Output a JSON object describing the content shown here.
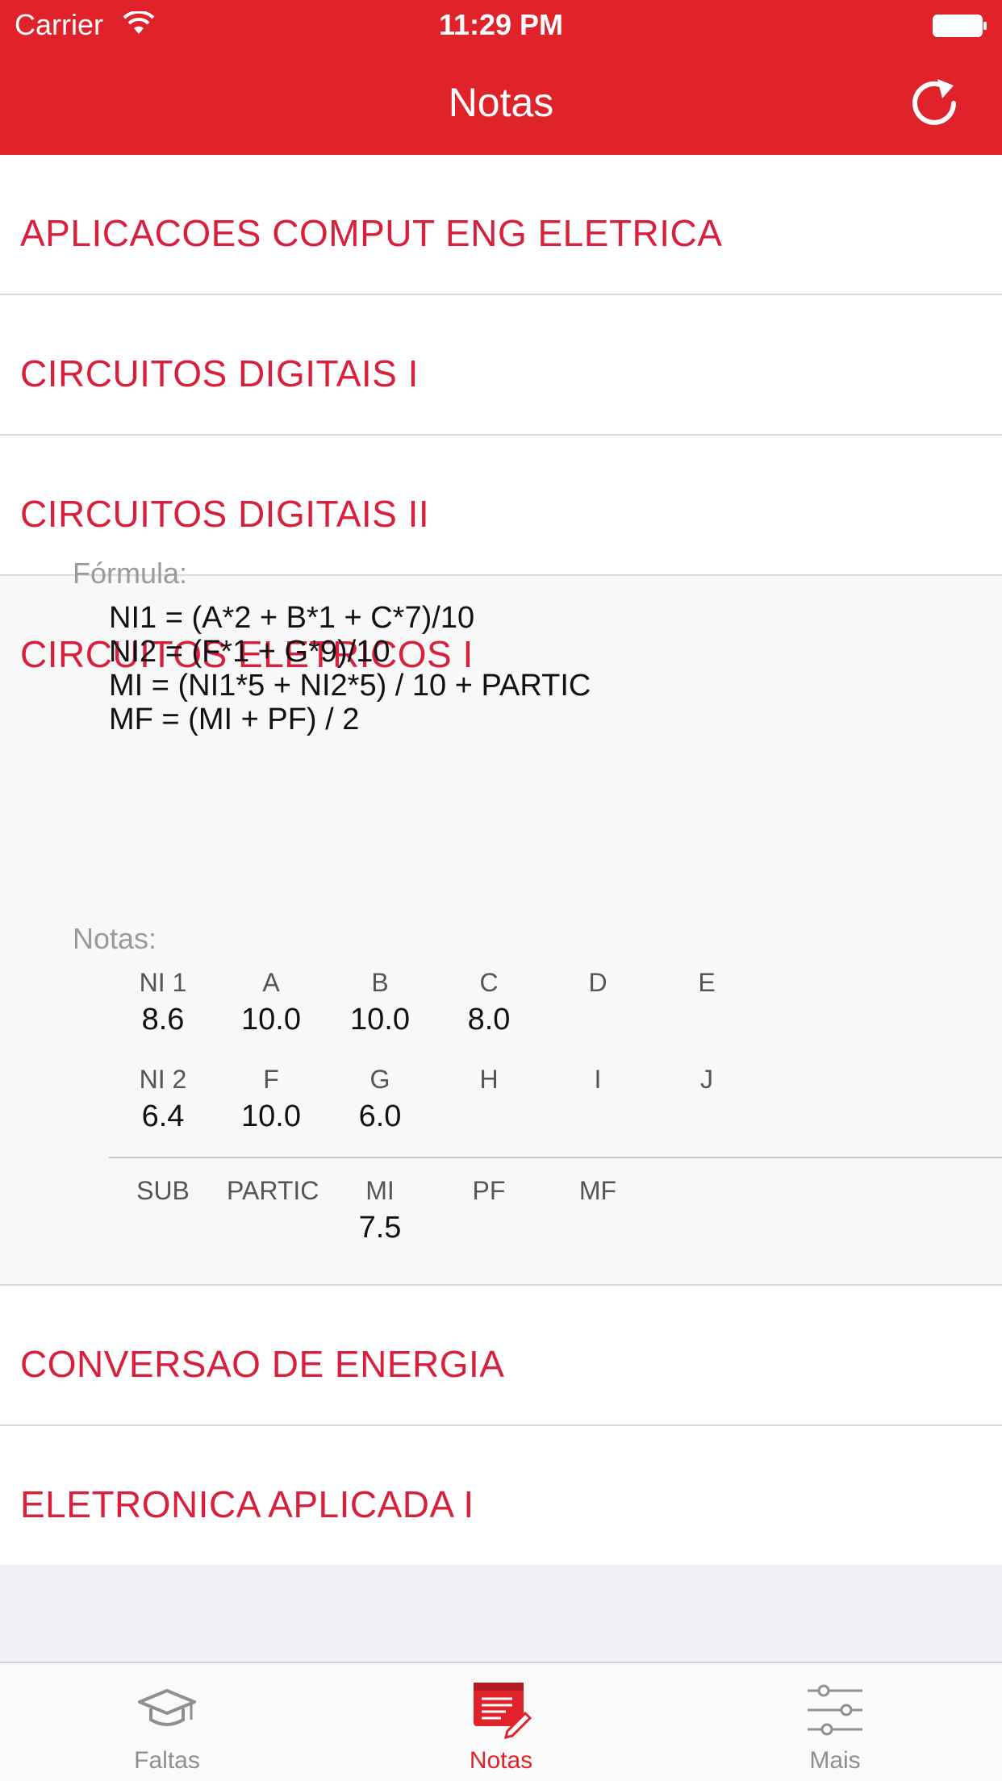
{
  "status_bar": {
    "carrier": "Carrier",
    "time": "11:29 PM"
  },
  "nav": {
    "title": "Notas",
    "refresh_icon": "refresh-icon"
  },
  "courses": [
    {
      "name": "APLICACOES COMPUT ENG ELETRICA"
    },
    {
      "name": "CIRCUITOS DIGITAIS I"
    },
    {
      "name": "CIRCUITOS DIGITAIS II"
    },
    {
      "name": "CIRCUITOS ELETRICOS I"
    },
    {
      "name": "CONVERSAO DE ENERGIA"
    },
    {
      "name": "ELETRONICA APLICADA I"
    }
  ],
  "expanded": {
    "formula_label": "Fórmula:",
    "formula": [
      "NI1  = (A*2 + B*1 + C*7)/10",
      "NI2  = (F*1 + G*9)/10",
      "MI = (NI1*5 + NI2*5) / 10 + PARTIC",
      "MF = (MI + PF) / 2"
    ],
    "notas_label": "Notas:",
    "row1": [
      {
        "h": "NI 1",
        "v": "8.6"
      },
      {
        "h": "A",
        "v": "10.0"
      },
      {
        "h": "B",
        "v": "10.0"
      },
      {
        "h": "C",
        "v": "8.0"
      },
      {
        "h": "D",
        "v": ""
      },
      {
        "h": "E",
        "v": ""
      }
    ],
    "row2": [
      {
        "h": "NI 2",
        "v": "6.4"
      },
      {
        "h": "F",
        "v": "10.0"
      },
      {
        "h": "G",
        "v": "6.0"
      },
      {
        "h": "H",
        "v": ""
      },
      {
        "h": "I",
        "v": ""
      },
      {
        "h": "J",
        "v": ""
      }
    ],
    "row3": [
      {
        "h": "SUB",
        "v": ""
      },
      {
        "h": "PARTIC",
        "v": ""
      },
      {
        "h": "MI",
        "v": "7.5"
      },
      {
        "h": "PF",
        "v": ""
      },
      {
        "h": "MF",
        "v": ""
      }
    ]
  },
  "tabs": [
    {
      "label": "Faltas",
      "icon": "graduation-cap-icon"
    },
    {
      "label": "Notas",
      "icon": "notes-icon"
    },
    {
      "label": "Mais",
      "icon": "sliders-icon"
    }
  ],
  "colors": {
    "brand": "#e0232b",
    "course_text": "#d81f3c",
    "tab_inactive": "#8e8e93"
  }
}
